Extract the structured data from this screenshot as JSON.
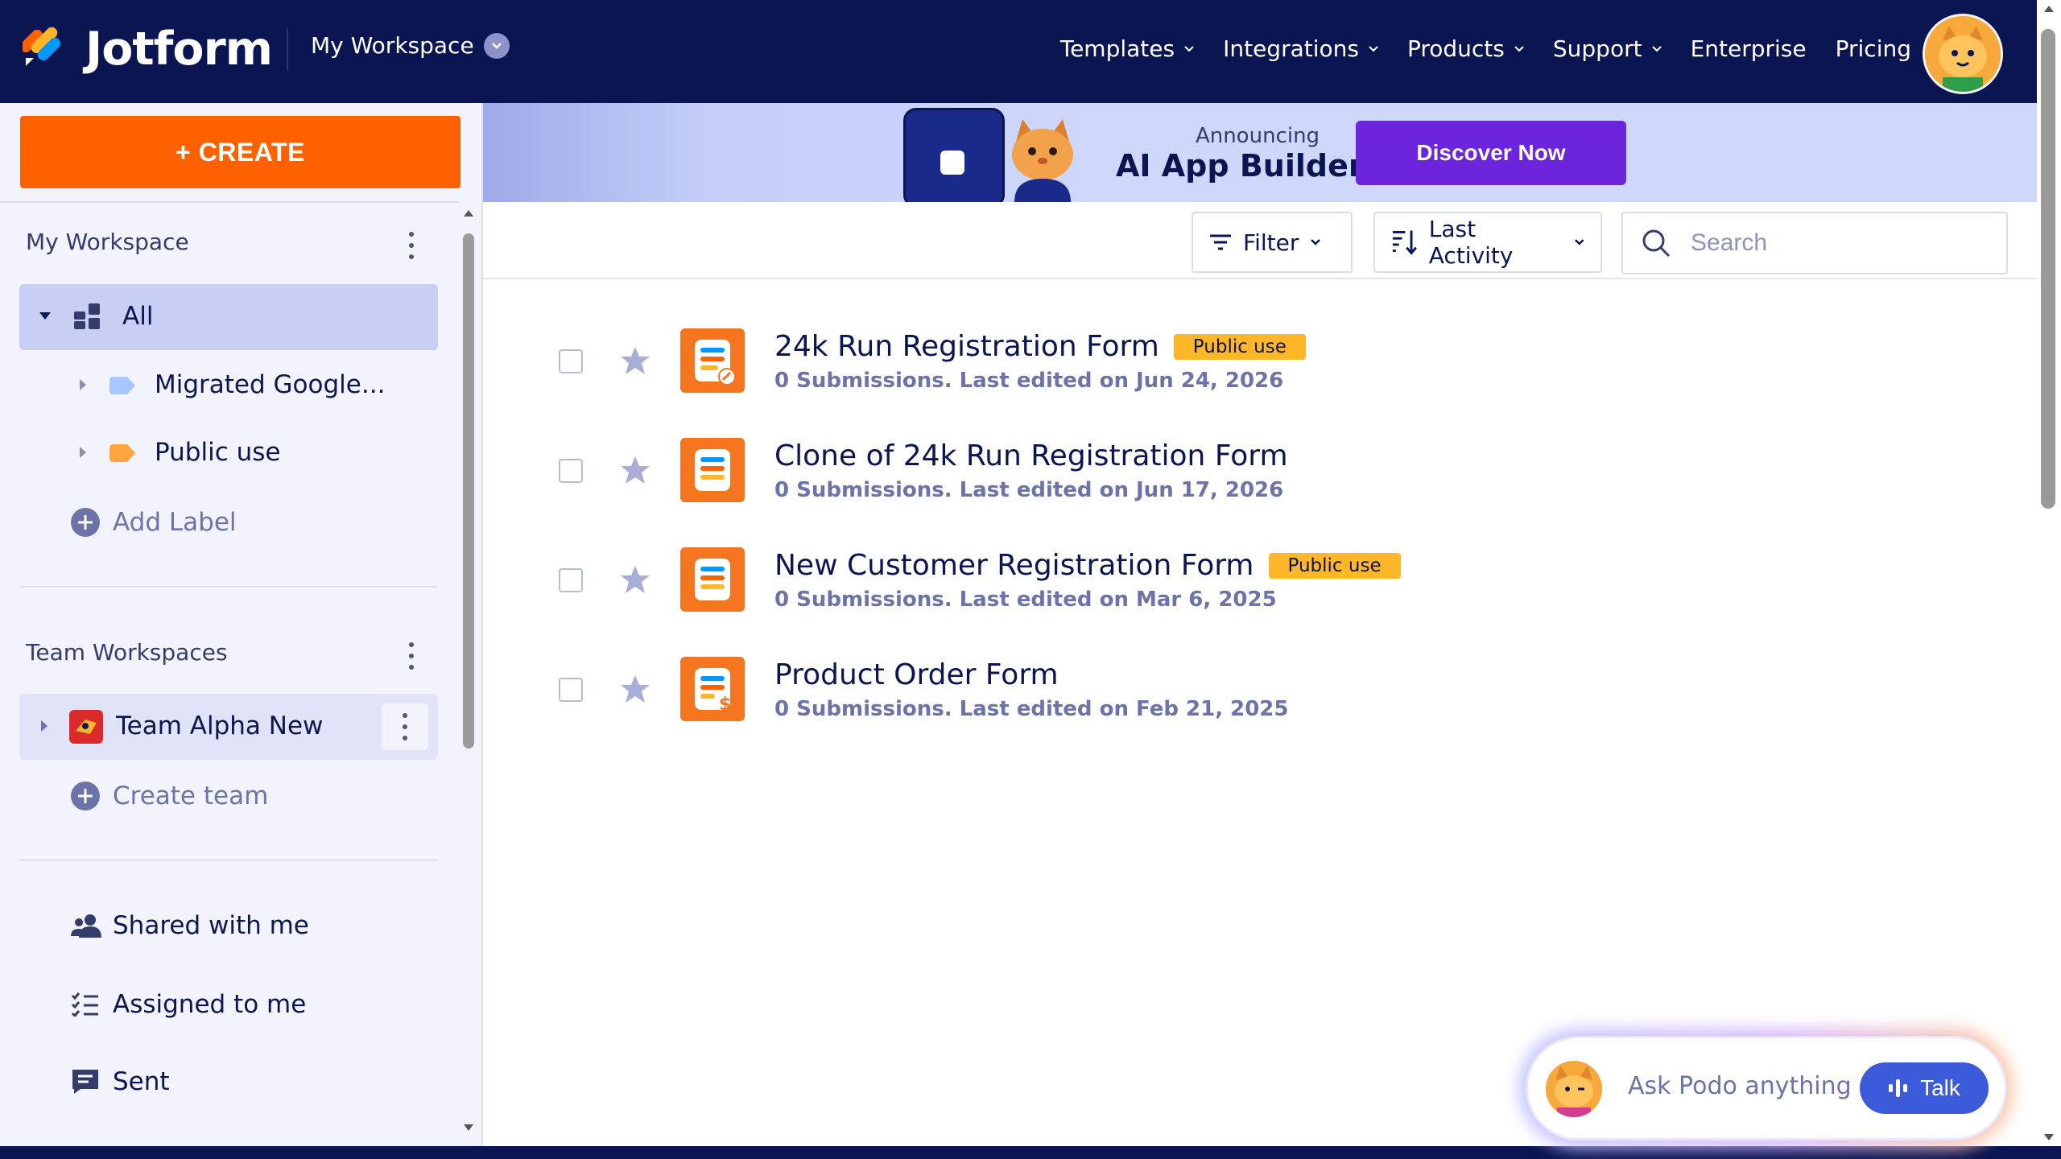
{
  "header": {
    "brand": "Jotform",
    "workspace": "My Workspace",
    "nav": [
      "Templates",
      "Integrations",
      "Products",
      "Support",
      "Enterprise",
      "Pricing"
    ]
  },
  "sidebar": {
    "create_label": "+ CREATE",
    "my_workspace_title": "My Workspace",
    "all_label": "All",
    "labels": [
      {
        "name": "Migrated Google...",
        "color": "#a8c6ff"
      },
      {
        "name": "Public use",
        "color": "#ffa53d"
      }
    ],
    "add_label": "Add Label",
    "team_workspaces_title": "Team Workspaces",
    "team_name": "Team Alpha New",
    "create_team": "Create team",
    "links": [
      "Shared with me",
      "Assigned to me",
      "Sent"
    ]
  },
  "banner": {
    "announcing": "Announcing",
    "title": "AI App Builder",
    "cta": "Discover Now"
  },
  "toolbar": {
    "filter": "Filter",
    "sort": "Last Activity",
    "search_placeholder": "Search"
  },
  "forms": [
    {
      "title": "24k Run Registration Form",
      "badge": "Public use",
      "meta": "0 Submissions. Last edited on Jun 24, 2026",
      "icon": "form-icon-edit"
    },
    {
      "title": "Clone of 24k Run Registration Form",
      "badge": "",
      "meta": "0 Submissions. Last edited on Jun 17, 2026",
      "icon": "form-icon"
    },
    {
      "title": "New Customer Registration Form",
      "badge": "Public use",
      "meta": "0 Submissions. Last edited on Mar 6, 2025",
      "icon": "form-icon"
    },
    {
      "title": "Product Order Form",
      "badge": "",
      "meta": "0 Submissions. Last edited on Feb 21, 2025",
      "icon": "form-icon-payment"
    }
  ],
  "podo": {
    "placeholder": "Ask Podo anything",
    "talk": "Talk"
  },
  "colors": {
    "navy": "#0a1551",
    "create": "#ff6100",
    "discover": "#6c24dc",
    "badge": "#ffb629",
    "talk": "#3b5bdb"
  }
}
